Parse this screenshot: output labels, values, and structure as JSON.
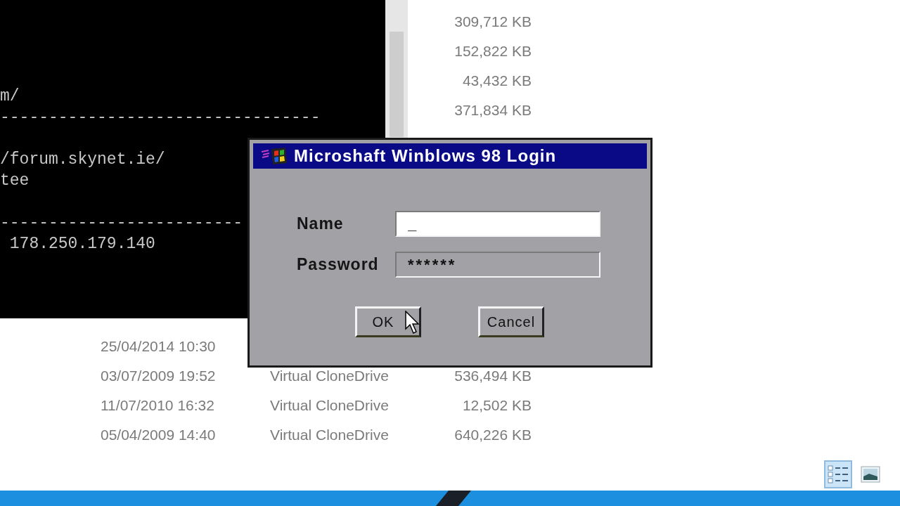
{
  "terminal": {
    "blocks": [
      [
        "m/",
        "---------------------------------"
      ],
      [
        "/forum.skynet.ie/",
        "tee"
      ],
      [
        "-------------------------",
        " 178.250.179.140"
      ]
    ]
  },
  "explorer": {
    "groups": [
      {
        "rows": [
          {
            "size": "309,712 KB"
          },
          {
            "size": "152,822 KB"
          },
          {
            "size": "43,432 KB"
          },
          {
            "size": "371,834 KB"
          }
        ]
      },
      {
        "rows": [
          {
            "date": "25/04/2014 10:30"
          },
          {
            "date": "03/07/2009 19:52",
            "type": "Virtual CloneDrive",
            "size": "536,494 KB"
          },
          {
            "date": "11/07/2010 16:32",
            "type": "Virtual CloneDrive",
            "size": "12,502 KB"
          },
          {
            "date": "05/04/2009 14:40",
            "type": "Virtual CloneDrive",
            "size": "640,226 KB"
          }
        ]
      }
    ],
    "view_buttons": [
      {
        "kind": "details",
        "selected": true
      },
      {
        "kind": "preview",
        "selected": false
      }
    ]
  },
  "dialog": {
    "title": "Microshaft Winblows 98 Login",
    "fields": [
      {
        "label": "Name",
        "value": "_",
        "focused": true
      },
      {
        "label": "Password",
        "value": "******",
        "focused": false
      }
    ],
    "buttons": [
      {
        "label": "OK",
        "hovered": true
      },
      {
        "label": "Cancel",
        "hovered": false
      }
    ]
  }
}
